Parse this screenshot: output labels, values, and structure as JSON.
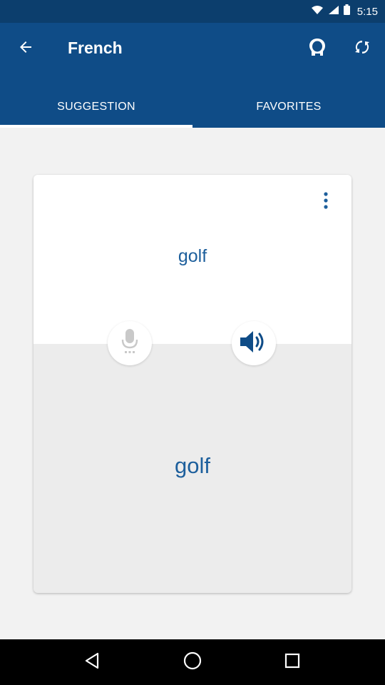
{
  "status_bar": {
    "time": "5:15"
  },
  "app_bar": {
    "title": "French",
    "back_icon": "arrow-left-icon",
    "head_icon": "head-icon",
    "refresh_icon": "refresh-icon",
    "background": "#0f4c87"
  },
  "tabs": [
    {
      "label": "SUGGESTION",
      "selected": true
    },
    {
      "label": "FAVORITES",
      "selected": false
    }
  ],
  "card": {
    "source_word": "golf",
    "translated_word": "golf",
    "menu_icon": "more-vertical-icon",
    "mic_icon": "microphone-icon",
    "speaker_icon": "speaker-icon",
    "word_color": "#1d5f9c"
  },
  "nav_bar": {
    "back_icon": "nav-back-icon",
    "home_icon": "nav-home-icon",
    "recents_icon": "nav-recents-icon"
  }
}
